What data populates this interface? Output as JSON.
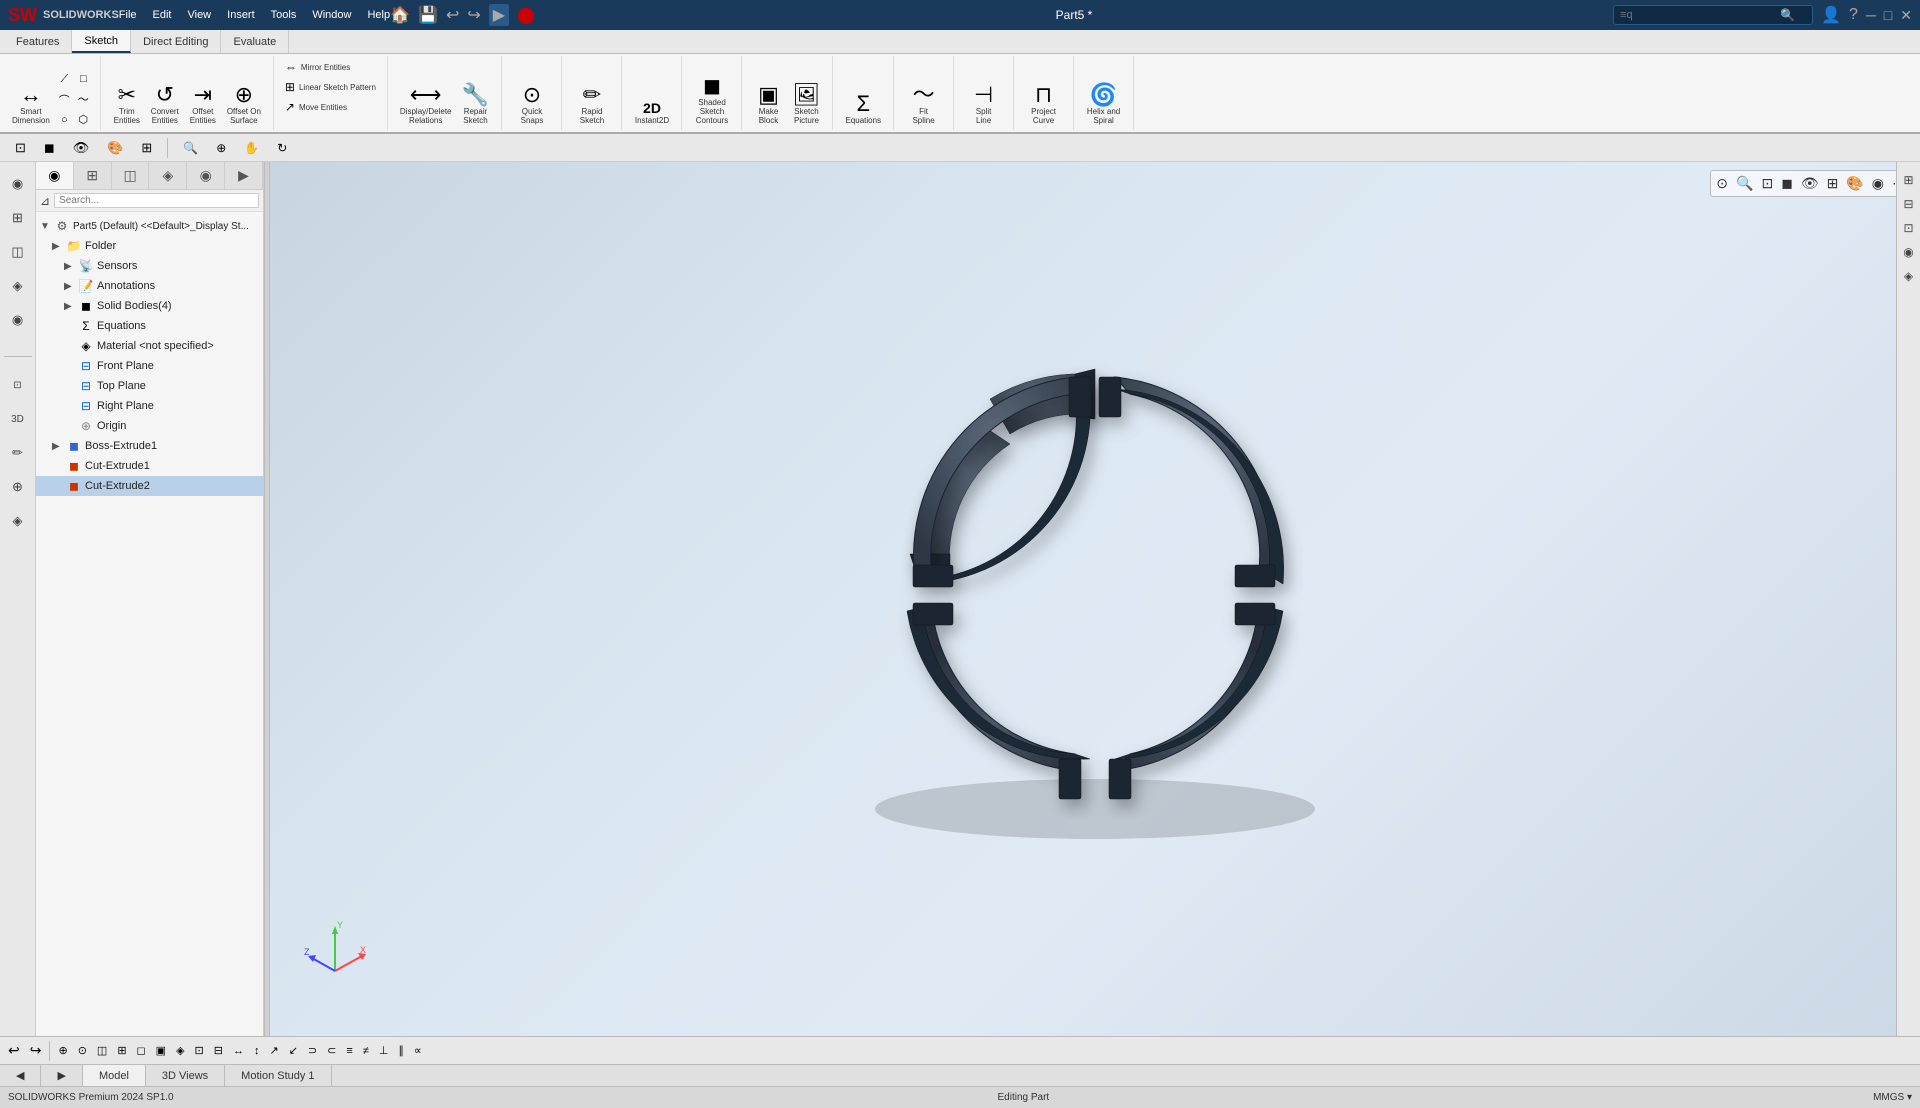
{
  "app": {
    "name": "SOLIDWORKS",
    "version": "SOLIDWORKS Premium 2024 SP1.0",
    "title": "Part5 *",
    "logo": "SW"
  },
  "titlebar": {
    "menus": [
      "File",
      "Edit",
      "View",
      "Insert",
      "Tools",
      "Window",
      "Help"
    ],
    "search_placeholder": "≡q",
    "win_controls": [
      "─",
      "□",
      "✕"
    ]
  },
  "command_tabs": [
    {
      "label": "Features",
      "active": false
    },
    {
      "label": "Sketch",
      "active": true
    },
    {
      "label": "Direct Editing",
      "active": false
    },
    {
      "label": "Evaluate",
      "active": false
    }
  ],
  "ribbon": {
    "groups": [
      {
        "label": "",
        "tools": [
          {
            "label": "Smart\nDimension",
            "icon": "↔"
          },
          {
            "label": "",
            "icon": "⟋"
          }
        ]
      },
      {
        "label": "",
        "tools": [
          {
            "label": "Trim\nEntities",
            "icon": "✂"
          },
          {
            "label": "Convert\nEntities",
            "icon": "↺"
          },
          {
            "label": "Offset\nEntities",
            "icon": "⇥"
          },
          {
            "label": "Offset On\nSurface",
            "icon": "⊕"
          }
        ]
      },
      {
        "label": "",
        "tools": [
          {
            "label": "Mirror Entities",
            "icon": "⇔"
          },
          {
            "label": "Linear Sketch Pattern",
            "icon": "⊞"
          },
          {
            "label": "Move Entities",
            "icon": "↗"
          }
        ]
      },
      {
        "label": "",
        "tools": [
          {
            "label": "Display/Delete\nRelations",
            "icon": "⟷"
          },
          {
            "label": "Repair\nSketch",
            "icon": "🔧"
          }
        ]
      },
      {
        "label": "",
        "tools": [
          {
            "label": "Quick\nSnaps",
            "icon": "⊙"
          }
        ]
      },
      {
        "label": "",
        "tools": [
          {
            "label": "Rapid\nSketch",
            "icon": "✏"
          }
        ]
      },
      {
        "label": "",
        "tools": [
          {
            "label": "Instant2D",
            "icon": "2D"
          }
        ]
      },
      {
        "label": "",
        "tools": [
          {
            "label": "Shaded\nSketch\nContours",
            "icon": "◼"
          }
        ]
      },
      {
        "label": "",
        "tools": [
          {
            "label": "Make\nBlock",
            "icon": "▣"
          },
          {
            "label": "Sketch\nPicture",
            "icon": "🖼"
          }
        ]
      },
      {
        "label": "",
        "tools": [
          {
            "label": "Equations",
            "icon": "Σ"
          }
        ]
      },
      {
        "label": "",
        "tools": [
          {
            "label": "Fit\nSpline",
            "icon": "~"
          }
        ]
      },
      {
        "label": "",
        "tools": [
          {
            "label": "Split\nLine",
            "icon": "⊣"
          }
        ]
      },
      {
        "label": "",
        "tools": [
          {
            "label": "Project\nCurve",
            "icon": "⊓"
          }
        ]
      },
      {
        "label": "",
        "tools": [
          {
            "label": "Helix and\nSpiral",
            "icon": "🌀"
          }
        ]
      }
    ]
  },
  "feature_tabs": [
    {
      "icon": "◉",
      "label": "FeatureManager"
    },
    {
      "icon": "⊞",
      "label": "PropertyManager"
    },
    {
      "icon": "◫",
      "label": "ConfigurationManager"
    },
    {
      "icon": "◈",
      "label": "DimXpert"
    },
    {
      "icon": "◉",
      "label": "DisplayManager"
    },
    {
      "icon": "▶",
      "label": "More"
    }
  ],
  "feature_tree": {
    "root": "Part5 (Default) <<Default>_Display St...",
    "items": [
      {
        "label": "Folder",
        "type": "folder",
        "expanded": false,
        "depth": 1
      },
      {
        "label": "Sensors",
        "type": "sensor",
        "expanded": false,
        "depth": 2
      },
      {
        "label": "Annotations",
        "type": "annotation",
        "expanded": false,
        "depth": 2
      },
      {
        "label": "Solid Bodies(4)",
        "type": "solid",
        "expanded": false,
        "depth": 2
      },
      {
        "label": "Equations",
        "type": "equation",
        "expanded": false,
        "depth": 2
      },
      {
        "label": "Material <not specified>",
        "type": "material",
        "expanded": false,
        "depth": 2
      },
      {
        "label": "Front Plane",
        "type": "plane",
        "expanded": false,
        "depth": 2
      },
      {
        "label": "Top Plane",
        "type": "plane",
        "expanded": false,
        "depth": 2
      },
      {
        "label": "Right Plane",
        "type": "plane",
        "expanded": false,
        "depth": 2
      },
      {
        "label": "Origin",
        "type": "origin",
        "expanded": false,
        "depth": 2
      },
      {
        "label": "Boss-Extrude1",
        "type": "feature",
        "expanded": false,
        "depth": 1
      },
      {
        "label": "Cut-Extrude1",
        "type": "feature",
        "expanded": false,
        "depth": 1
      },
      {
        "label": "Cut-Extrude2",
        "type": "feature",
        "expanded": false,
        "depth": 1,
        "selected": true
      }
    ]
  },
  "bottom_tabs": [
    {
      "label": "Model",
      "active": true
    },
    {
      "label": "3D Views",
      "active": false
    },
    {
      "label": "Motion Study 1",
      "active": false
    }
  ],
  "statusbar": {
    "left": "SOLIDWORKS Premium 2024 SP1.0",
    "center": "Editing Part",
    "right": "MMGS ▾"
  },
  "view_toolbar_buttons": [
    "◻",
    "◼",
    "≡",
    "◫",
    "✦",
    "⊕",
    "◉",
    "⊡",
    "⊞",
    "≋"
  ],
  "axes": {
    "x_color": "#ff4444",
    "y_color": "#44cc44",
    "z_color": "#4444ff"
  }
}
